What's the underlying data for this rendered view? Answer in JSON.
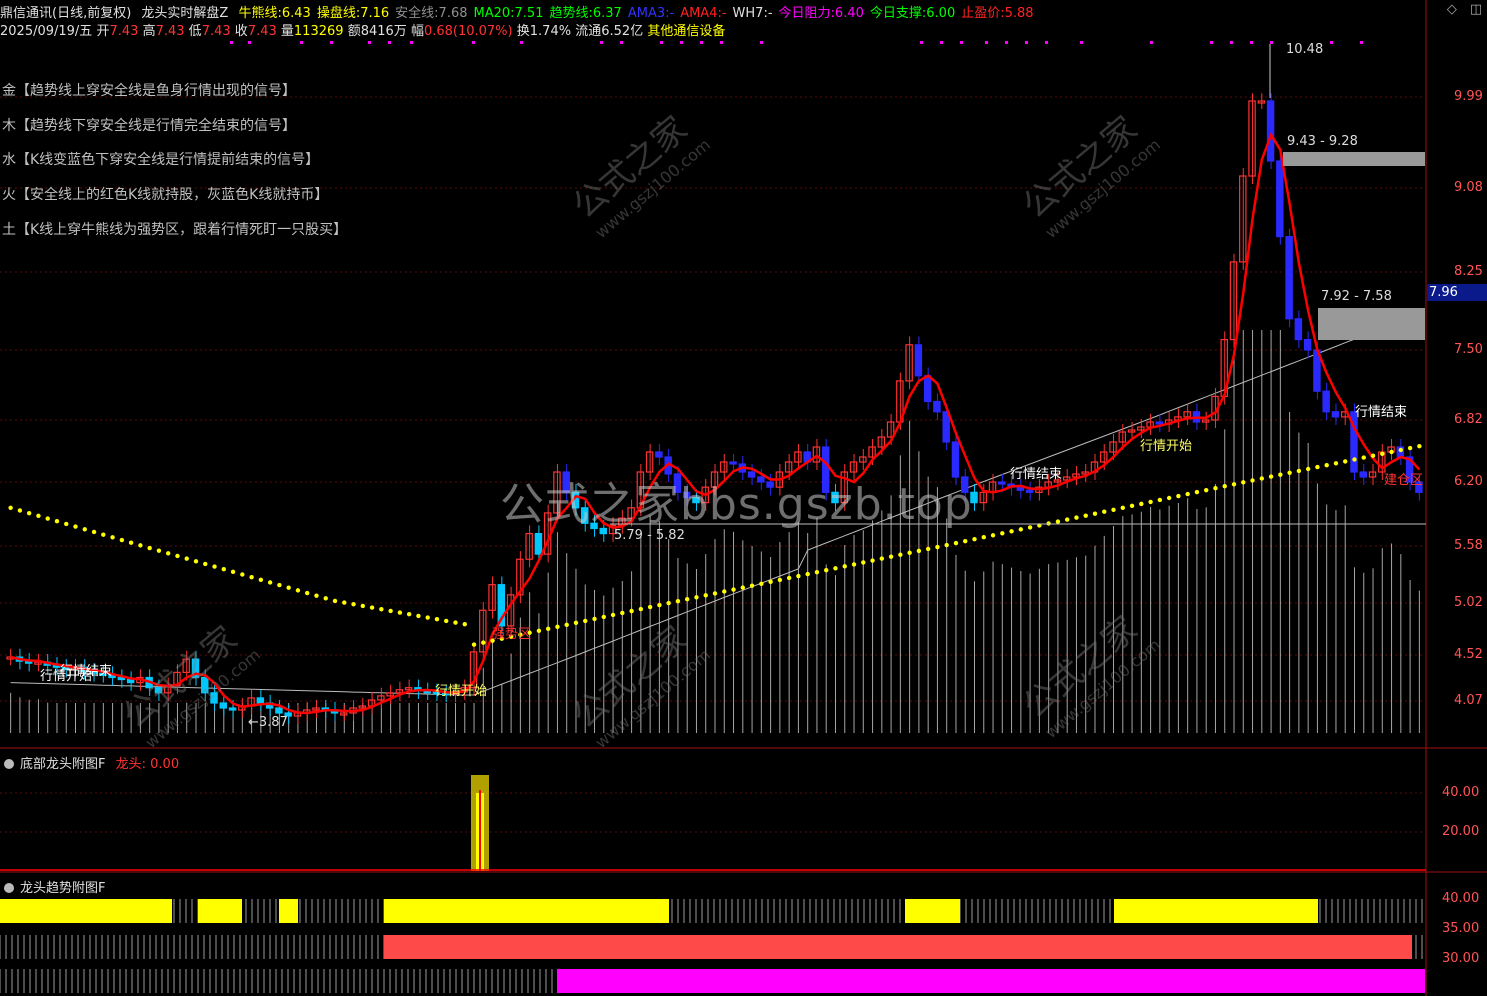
{
  "header": {
    "app_title": "鼎信通讯(日线,前复权)",
    "indicator_name": "龙头实时解盘Z",
    "indicators": [
      {
        "label": "牛熊线:",
        "value": "6.43",
        "color": "#ffff00"
      },
      {
        "label": "操盘线:",
        "value": "7.16",
        "color": "#ffff00"
      },
      {
        "label": "安全线:",
        "value": "7.68",
        "color": "#909090"
      },
      {
        "label": "MA20:",
        "value": "7.51",
        "color": "#00ff00"
      },
      {
        "label": "趋势线:",
        "value": "6.37",
        "color": "#00ff00"
      },
      {
        "label": "AMA3:",
        "value": "-",
        "color": "#3333ff"
      },
      {
        "label": "AMA4:",
        "value": "-",
        "color": "#ff2222"
      },
      {
        "label": "WH7:",
        "value": "-",
        "color": "#e0e0e0"
      },
      {
        "label": "今日阻力:",
        "value": "6.40",
        "color": "#ff00ff"
      },
      {
        "label": "今日支撑:",
        "value": "6.00",
        "color": "#00ff00"
      },
      {
        "label": "止盈价:",
        "value": "5.88",
        "color": "#ff2222"
      }
    ],
    "quote": {
      "date": "2025/09/19/五",
      "open_label": "开",
      "open": "7.43",
      "high_label": "高",
      "high": "7.43",
      "low_label": "低",
      "low": "7.43",
      "close_label": "收",
      "close": "7.43",
      "vol_label": "量",
      "vol": "113269",
      "amt_label": "额",
      "amt": "8416万",
      "chg_label": "幅",
      "chg": "0.68(10.07%)",
      "turn_label": "换",
      "turn": "1.74%",
      "float_label": "流通",
      "float": "6.52亿",
      "sector": "其他通信设备"
    }
  },
  "signals": [
    {
      "text": "金【趋势线上穿安全线是鱼身行情出现的信号】",
      "color": "#ffff00"
    },
    {
      "text": "木【趋势线下穿安全线是行情完全结束的信号】",
      "color": "#00ff00"
    },
    {
      "text": "水【K线变蓝色下穿安全线是行情提前结束的信号】",
      "color": "#ff00ff"
    },
    {
      "text": "火【安全线上的红色K线就持股，灰蓝色K线就持币】",
      "color": "#ff3333"
    },
    {
      "text": "土【K线上穿牛熊线为强势区，跟着行情死盯一只股买】",
      "color": "#00ffff"
    }
  ],
  "main_chart": {
    "y_labels": [
      "9.99",
      "9.08",
      "8.25",
      "7.50",
      "6.82",
      "6.20",
      "5.58",
      "5.02",
      "4.52",
      "4.07"
    ],
    "current_price": "7.96",
    "notes": {
      "peak": "10.48",
      "zone_top": "9.43 - 9.28",
      "zone_mid": "7.92 - 7.58",
      "zone_low": "5.79 - 5.82",
      "low_point": "3.87",
      "start1": "行情开始",
      "end1": "行情结束",
      "start2": "行情开始",
      "end2": "行情结束",
      "start3": "行情开始",
      "end3": "行情结束",
      "strong": "强势区",
      "end_right": "建仓区"
    },
    "watermark": "公式之家bbs.gszb.top",
    "watermark_small": "公式之家",
    "watermark_url": "www.gszj100.com"
  },
  "pane2": {
    "title": "底部龙头附图F",
    "label": "龙头:",
    "value": "0.00",
    "y_labels": [
      "40.00",
      "20.00"
    ]
  },
  "pane3": {
    "title": "龙头趋势附图F",
    "y_labels": [
      "40.00",
      "35.00",
      "30.00"
    ]
  },
  "colors": {
    "up": "#ff3333",
    "down": "#00c8ff",
    "blue_candle": "#2a2aff",
    "trend_red": "#ff0000",
    "trend_green": "#00ff00",
    "dotted": "#ffff00",
    "axis": "#a01010"
  }
}
